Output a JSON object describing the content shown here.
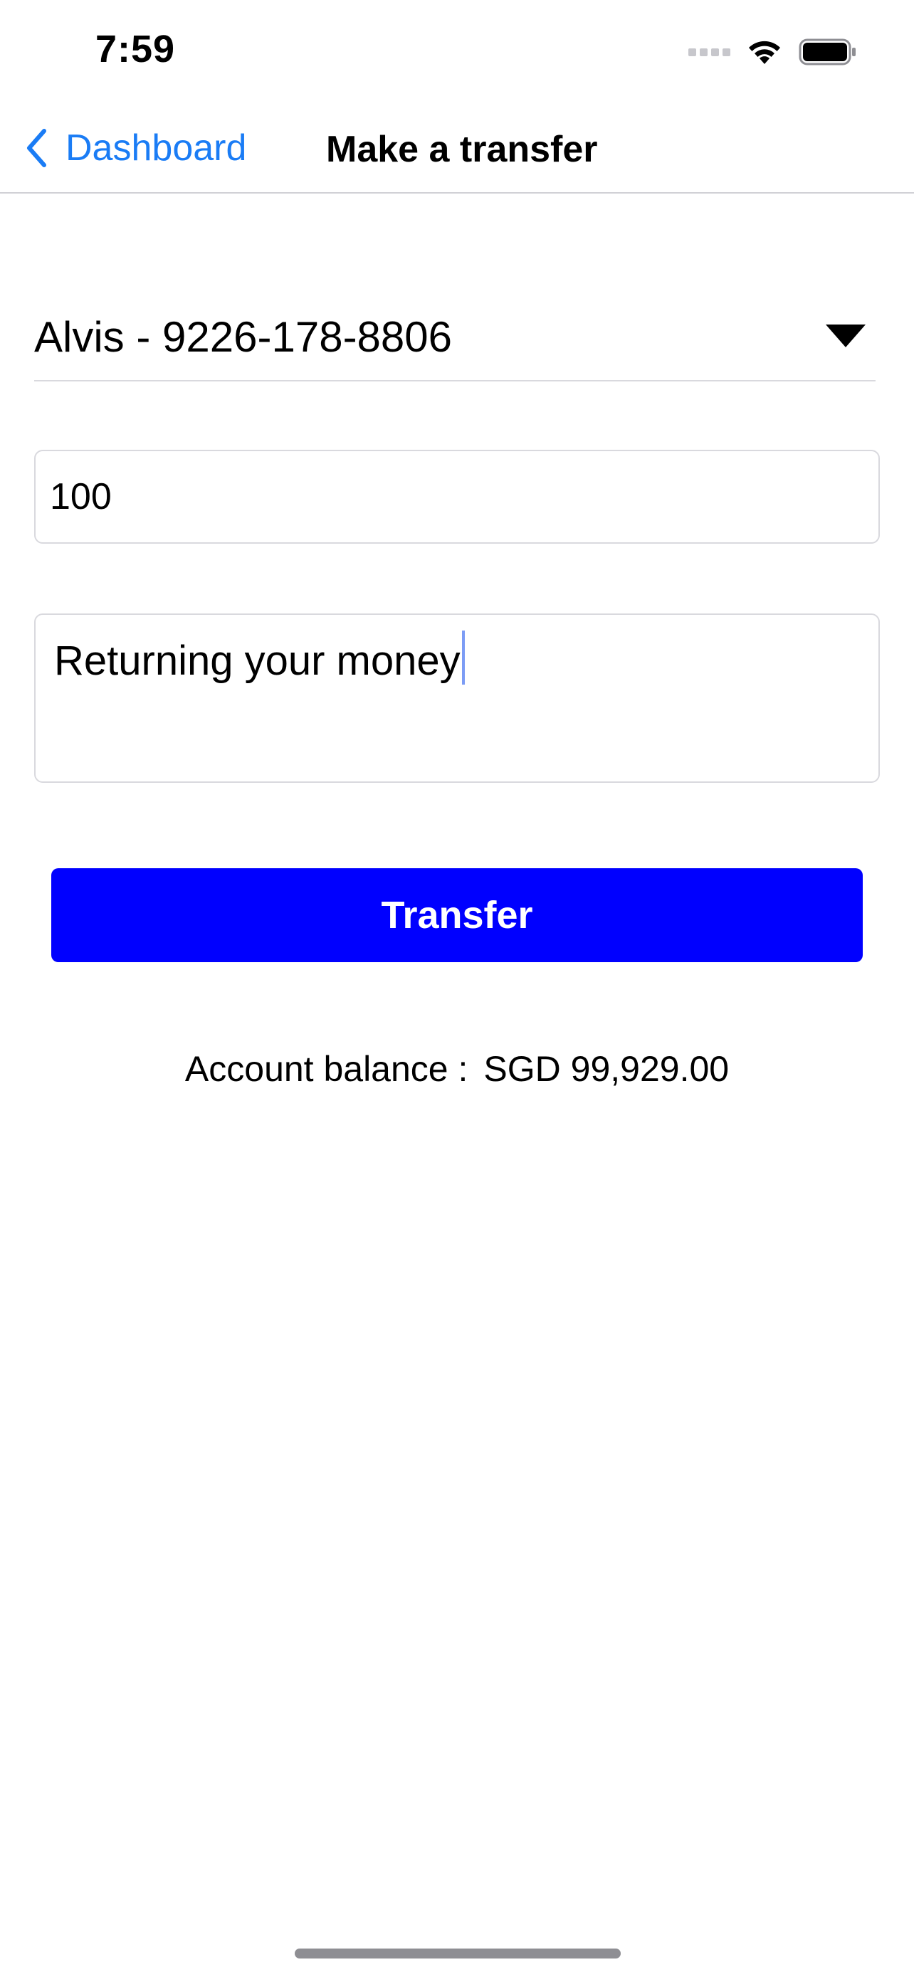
{
  "status_bar": {
    "time": "7:59"
  },
  "nav": {
    "back_label": "Dashboard",
    "title": "Make a transfer"
  },
  "form": {
    "recipient": "Alvis - 9226-178-8806",
    "amount": "100",
    "message": "Returning your money",
    "submit_label": "Transfer"
  },
  "balance": {
    "label": "Account balance :",
    "value": "SGD 99,929.00"
  },
  "colors": {
    "accent": "#1a7cf5",
    "button": "#0000ff",
    "caret": "#7c9cf5"
  },
  "icons": {
    "back": "chevron-left-icon",
    "dropdown": "triangle-down-icon",
    "wifi": "wifi-icon",
    "battery": "battery-icon",
    "signal": "cellular-signal-icon"
  }
}
